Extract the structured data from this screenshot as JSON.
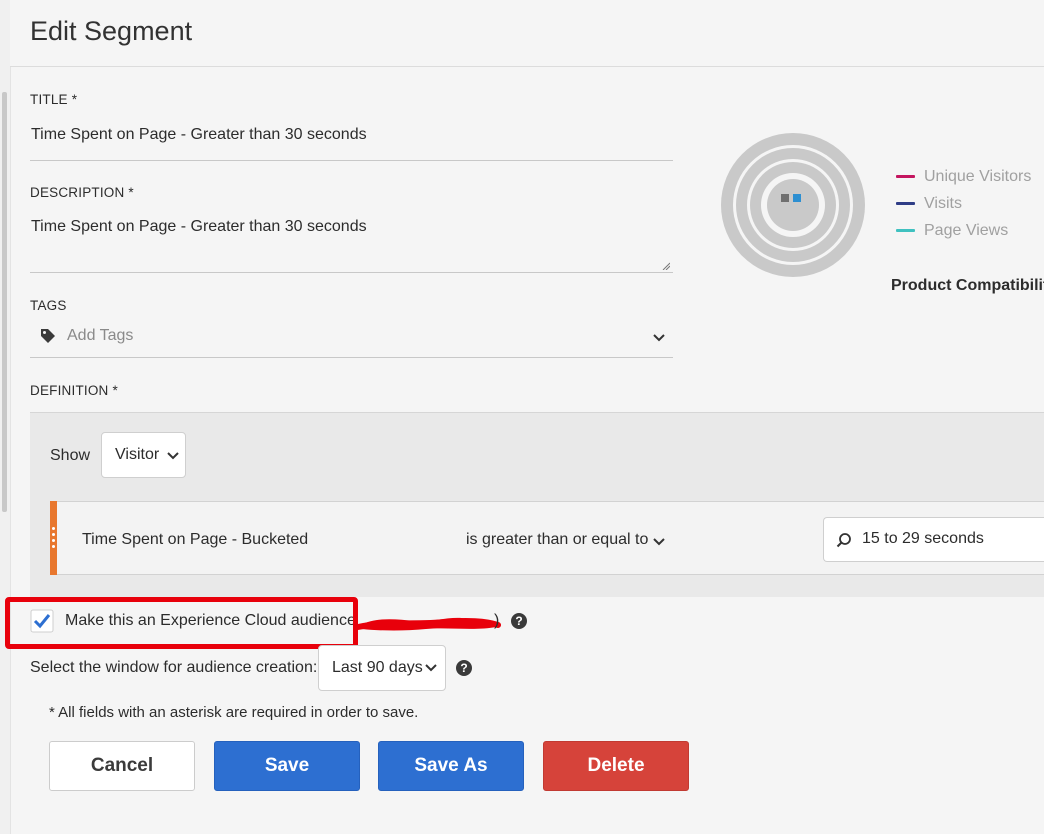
{
  "header": {
    "title": "Edit Segment"
  },
  "form": {
    "title_label": "TITLE *",
    "title_value": "Time Spent on Page - Greater than 30 seconds",
    "description_label": "DESCRIPTION *",
    "description_value": "Time Spent on Page - Greater than 30 seconds",
    "tags_label": "TAGS",
    "tags_placeholder": "Add Tags",
    "definition_label": "DEFINITION *"
  },
  "definition": {
    "show_label": "Show",
    "show_value": "Visitor",
    "rule": {
      "dimension": "Time Spent on Page - Bucketed",
      "operator": "is greater than or equal to",
      "value": "15 to 29 seconds"
    }
  },
  "audience": {
    "checkbox_label": "Make this an Experience Cloud audience",
    "checked": true,
    "partial_text": ")",
    "window_label": "Select the window for audience creation:",
    "window_value": "Last 90 days"
  },
  "footer": {
    "required_note": "* All fields with an asterisk are required in order to save.",
    "cancel": "Cancel",
    "save": "Save",
    "save_as": "Save As",
    "delete": "Delete"
  },
  "preview": {
    "legend": [
      {
        "label": "Unique Visitors",
        "color": "#c4155f"
      },
      {
        "label": "Visits",
        "color": "#2f3d86"
      },
      {
        "label": "Page Views",
        "color": "#3fc1c0"
      }
    ],
    "compat_label": "Product Compatibility"
  },
  "colors": {
    "accent_blue": "#2d6fd1",
    "delete_red": "#d6433a",
    "rule_accent": "#e8772e",
    "annotation_red": "#e8000b"
  },
  "icons": [
    "tag-icon",
    "chevron-down-icon",
    "search-icon",
    "checkmark-icon",
    "help-icon",
    "grip-icon",
    "resize-handle-icon",
    "segment-ring-chart"
  ]
}
